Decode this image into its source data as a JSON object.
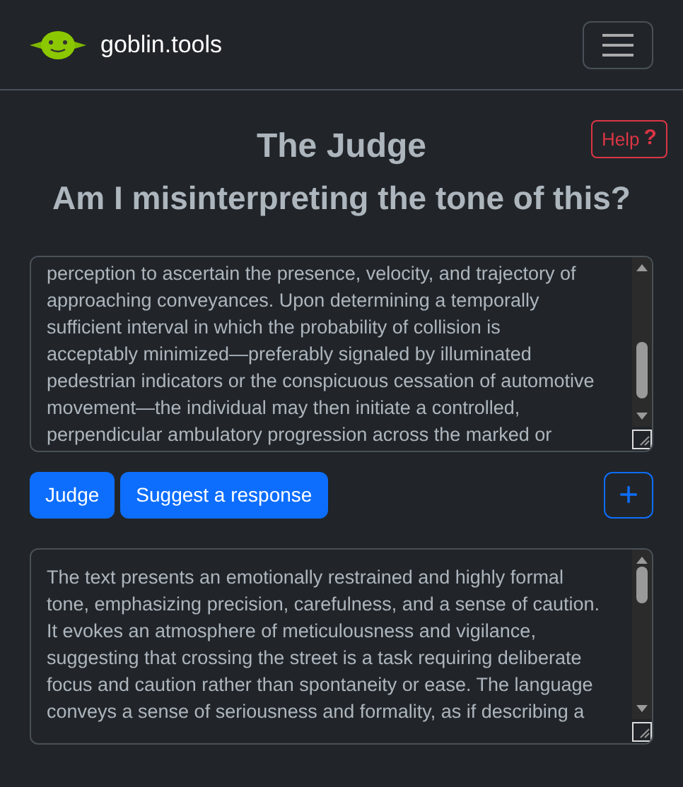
{
  "navbar": {
    "brand": "goblin.tools"
  },
  "header": {
    "title": "The Judge",
    "subtitle": "Am I misinterpreting the tone of this?",
    "help_button": {
      "label": "Help",
      "icon": "?"
    }
  },
  "input_text": {
    "lines": [
      "perception to ascertain the presence, velocity, and trajectory of",
      "approaching conveyances. Upon determining a temporally",
      "sufficient interval in which the probability of collision is",
      "acceptably minimized—preferably signaled by illuminated",
      "pedestrian indicators or the conspicuous cessation of automotive",
      "movement—the individual may then initiate a controlled,",
      "perpendicular ambulatory progression across the marked or"
    ]
  },
  "actions": {
    "buttons": [
      "Judge",
      "Suggest a response"
    ],
    "add_button": "+"
  },
  "output_text": {
    "lines": [
      "The text presents an emotionally restrained and highly formal",
      "tone, emphasizing precision, carefulness, and a sense of caution.",
      "It evokes an atmosphere of meticulousness and vigilance,",
      "suggesting that crossing the street is a task requiring deliberate",
      "focus and caution rather than spontaneity or ease. The language",
      "conveys a sense of seriousness and formality, as if describing a"
    ]
  }
}
